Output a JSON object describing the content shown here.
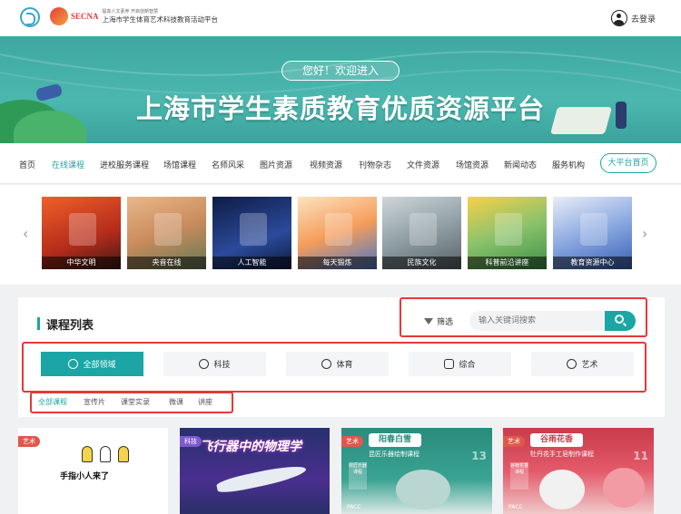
{
  "header": {
    "brand_name": "SECNA",
    "brand_small": "提高人文素养 开启创新智慧",
    "brand_title": "上海市学生体育艺术科技教育活动平台",
    "login_label": "去登录"
  },
  "banner": {
    "greeting": "您好！欢迎进入",
    "title": "上海市学生素质教育优质资源平台"
  },
  "nav": {
    "items": [
      "首页",
      "在线课程",
      "进校服务课程",
      "场馆课程",
      "名师风采",
      "图片资源",
      "视频资源",
      "刊物杂志",
      "文件资源",
      "场馆资源",
      "新闻动态",
      "服务机构"
    ],
    "active": "在线课程",
    "platform_home": "大平台首页"
  },
  "carousel": {
    "prev": "‹",
    "next": "›",
    "cards": [
      "中华文明",
      "央音在线",
      "人工智能",
      "每天锻炼",
      "民族文化",
      "科普前沿讲座",
      "教育资源中心"
    ]
  },
  "course_list": {
    "title": "课程列表",
    "filter_label": "筛选",
    "search_placeholder": "输入关键词搜索",
    "categories": [
      "全部领域",
      "科技",
      "体育",
      "综合",
      "艺术"
    ],
    "active_category": "全部领域",
    "sub_tabs": [
      "全部课程",
      "宣传片",
      "课堂实录",
      "微课",
      "讲座"
    ],
    "active_sub_tab": "全部课程"
  },
  "course_cards": [
    {
      "tag": "艺术",
      "title": "手指小人来了"
    },
    {
      "tag": "科技",
      "title": "飞行器中的物理学"
    },
    {
      "tag": "艺术",
      "title": "阳春白雪",
      "subtitle": "昆匠乐器绘制课程",
      "box": "昆匠乐器课程",
      "brand": "PACC",
      "num": "13"
    },
    {
      "tag": "艺术",
      "title": "谷雨花香",
      "subtitle": "牡丹花手工皂制作课程",
      "box": "谷雨花香课程",
      "brand": "PACC",
      "num": "11"
    }
  ],
  "colors": {
    "accent": "#1ba5a5",
    "highlight_box": "#e53935",
    "tag_red": "#e0584a"
  }
}
